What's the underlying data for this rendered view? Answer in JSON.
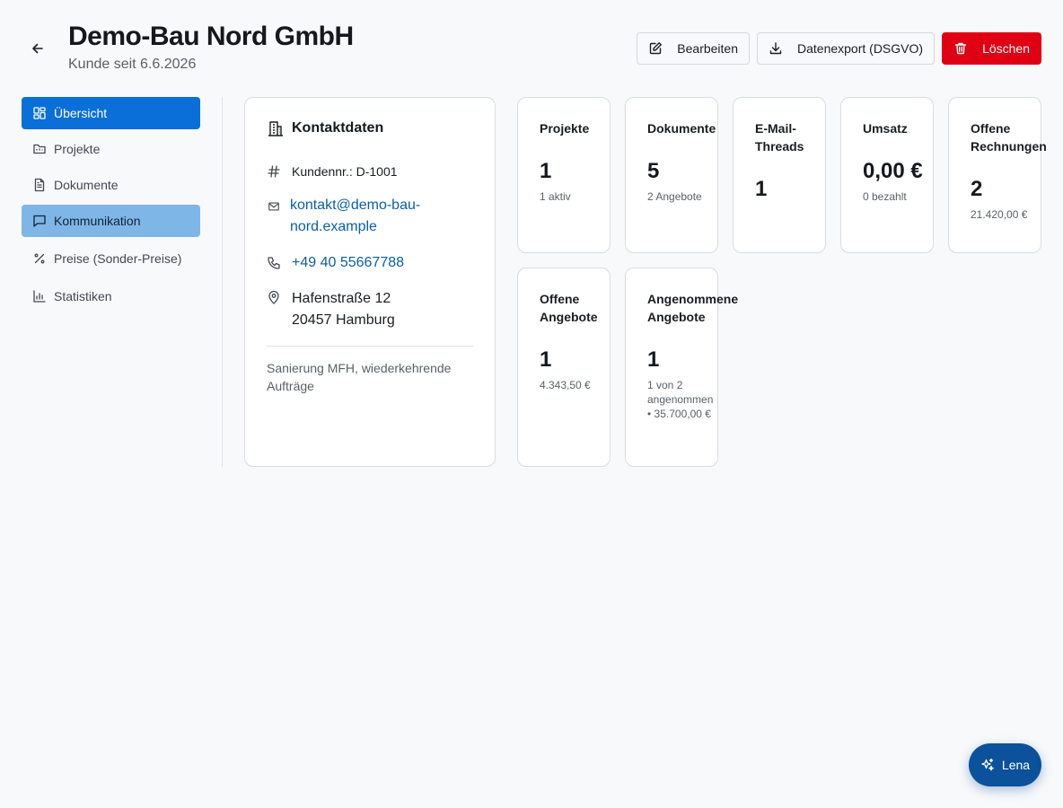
{
  "header": {
    "title": "Demo-Bau Nord GmbH",
    "subtitle": "Kunde seit 6.6.2026",
    "actions": {
      "edit": "Bearbeiten",
      "export": "Datenexport (DSGVO)",
      "delete": "Löschen"
    }
  },
  "sidebar": {
    "items": [
      {
        "label": "Übersicht",
        "icon": "grid-icon",
        "state": "active"
      },
      {
        "label": "Projekte",
        "icon": "folder-icon"
      },
      {
        "label": "Dokumente",
        "icon": "document-icon"
      },
      {
        "label": "Kommunikation",
        "icon": "message-icon",
        "state": "hover"
      },
      {
        "label": "Preise (Sonder-Preise)",
        "icon": "percent-icon"
      },
      {
        "label": "Statistiken",
        "icon": "bar-chart-icon"
      }
    ]
  },
  "contact": {
    "title": "Kontaktdaten",
    "customer_no_label": "Kundennr.:",
    "customer_no": "D-1001",
    "email": "kontakt@demo-bau-nord.example",
    "phone": "+49 40 55667788",
    "street": "Hafenstraße 12",
    "city": "20457 Hamburg",
    "note": "Sanierung MFH, wiederkehrende Aufträge"
  },
  "stats": [
    {
      "label": "Projekte",
      "value": "1",
      "sub": "1 aktiv"
    },
    {
      "label": "Dokumente",
      "value": "5",
      "sub": "2 Angebote"
    },
    {
      "label": "E-Mail-Threads",
      "value": "1",
      "sub": ""
    },
    {
      "label": "Umsatz",
      "value": "0,00 €",
      "sub": "0 bezahlt"
    },
    {
      "label": "Offene Rechnungen",
      "value": "2",
      "sub": "21.420,00 €"
    },
    {
      "label": "Offene Angebote",
      "value": "1",
      "sub": "4.343,50 €"
    },
    {
      "label": "Angenommene Angebote",
      "value": "1",
      "sub": "1 von 2 angenommen • 35.700,00 €"
    }
  ],
  "assistant": {
    "label": "Lena"
  },
  "colors": {
    "primary": "#0a6fd8",
    "danger": "#e00014",
    "link": "#0b5ea8",
    "fab": "#0c519c"
  }
}
